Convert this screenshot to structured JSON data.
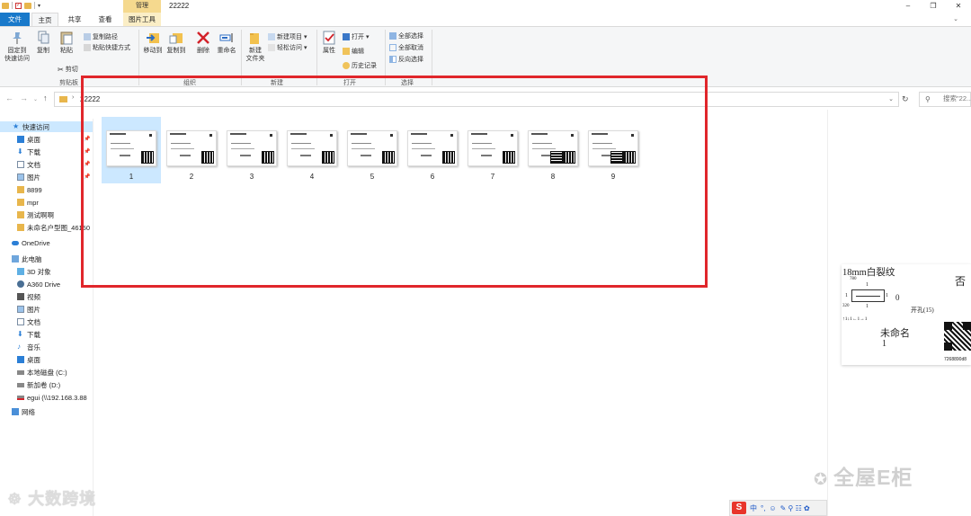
{
  "window": {
    "title": "22222",
    "context_tab_header": "管理",
    "controls": [
      "–",
      "❐",
      "✕"
    ]
  },
  "tabs": {
    "file": "文件",
    "home": "主页",
    "share": "共享",
    "view": "查看",
    "picture_tools": "图片工具"
  },
  "ribbon": {
    "clipboard": {
      "pin": "固定到\n快速访问",
      "copy": "复制",
      "paste": "粘贴",
      "copy_path": "复制路径",
      "paste_shortcut": "粘贴快捷方式",
      "cut": "剪切",
      "label": "剪贴板"
    },
    "organize": {
      "move_to": "移动到",
      "copy_to": "复制到",
      "delete": "删除",
      "rename": "重命名",
      "label": "组织"
    },
    "new": {
      "new_folder": "新建\n文件夹",
      "new_item": "新建项目",
      "easy_access": "轻松访问",
      "label": "新建"
    },
    "open": {
      "properties": "属性",
      "open": "打开",
      "edit": "编辑",
      "history": "历史记录",
      "label": "打开"
    },
    "select": {
      "select_all": "全部选择",
      "select_none": "全部取消",
      "invert": "反向选择",
      "label": "选择"
    }
  },
  "address": {
    "path": "22222",
    "search_placeholder": "搜索\"22..."
  },
  "nav": {
    "quick_access": "快速访问",
    "items": [
      "桌面",
      "下载",
      "文档",
      "图片",
      "8899",
      "mpr",
      "测试啊啊",
      "未命名户型图_46150"
    ],
    "onedrive": "OneDrive",
    "this_pc": "此电脑",
    "pc_items": [
      "3D 对象",
      "A360 Drive",
      "视频",
      "图片",
      "文档",
      "下载",
      "音乐",
      "桌面",
      "本地磁盘 (C:)",
      "新加卷 (D:)",
      "egui (\\\\192.168.3.88"
    ],
    "network": "网络"
  },
  "files": [
    "1",
    "2",
    "3",
    "4",
    "5",
    "6",
    "7",
    "8",
    "9"
  ],
  "preview": {
    "title": "18mm白裂纹",
    "no": "否",
    "dim_top": "780",
    "dim_left": "320",
    "one": "1",
    "zero": "0",
    "holes": "开孔(15)",
    "seq": "↑1↓1←1→1",
    "name": "未命名",
    "count": "1",
    "code": "7268890d8"
  },
  "ime": {
    "logo": "S",
    "lang": "中",
    "punct": "°,",
    "emoji": "☺",
    "icons": "✎ ⚲ ☷ ✿"
  },
  "watermarks": {
    "left": "大数跨境",
    "right": "全屋E柜"
  }
}
